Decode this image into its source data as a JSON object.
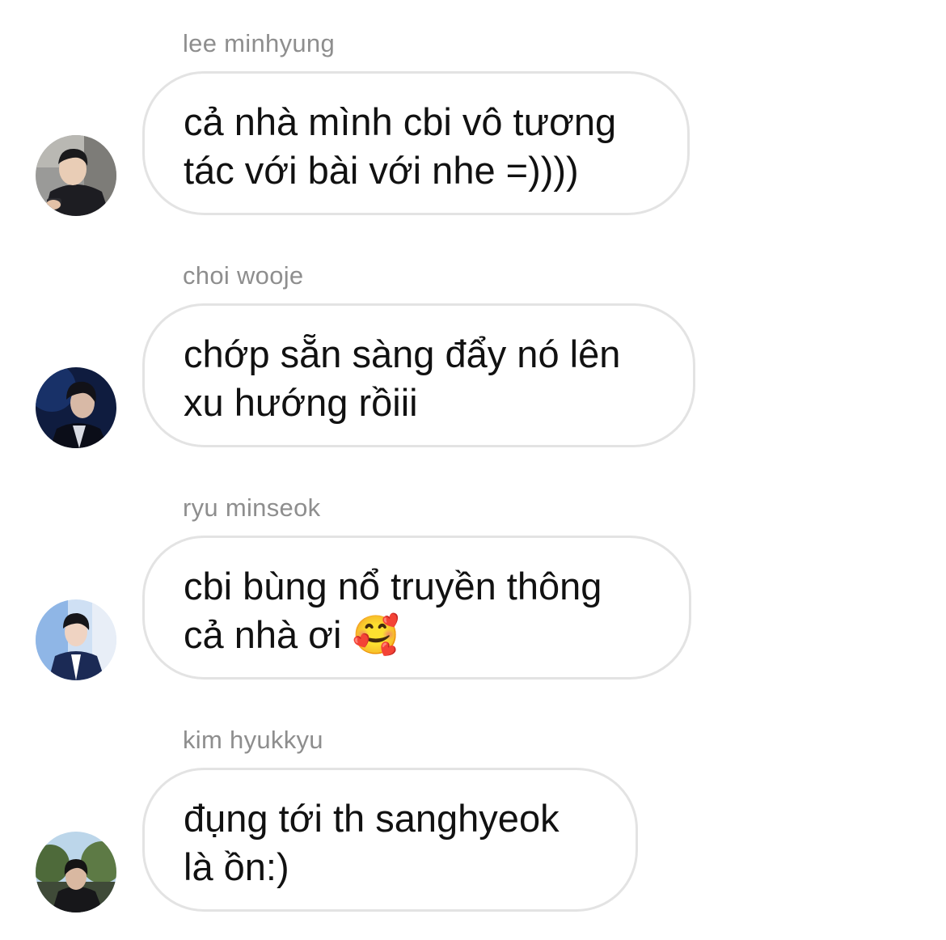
{
  "messages": [
    {
      "sender": "lee minhyung",
      "text": "cả nhà mình cbi vô tương\ntác với bài với nhe =))))",
      "avatar_icon": "user-photo-icon"
    },
    {
      "sender": "choi wooje",
      "text": "chớp sẵn sàng đẩy nó lên\nxu hướng rồiii",
      "avatar_icon": "user-photo-icon"
    },
    {
      "sender": "ryu minseok",
      "text": "cbi bùng nổ truyền thông\ncả nhà ơi 🥰",
      "avatar_icon": "user-photo-icon"
    },
    {
      "sender": "kim hyukkyu",
      "text": "đụng tới th sanghyeok\nlà ồn:)",
      "avatar_icon": "user-photo-icon"
    }
  ],
  "colors": {
    "background": "#ffffff",
    "bubble_border": "#e3e3e3",
    "sender_name": "#8e8e8e",
    "message_text": "#111111"
  }
}
